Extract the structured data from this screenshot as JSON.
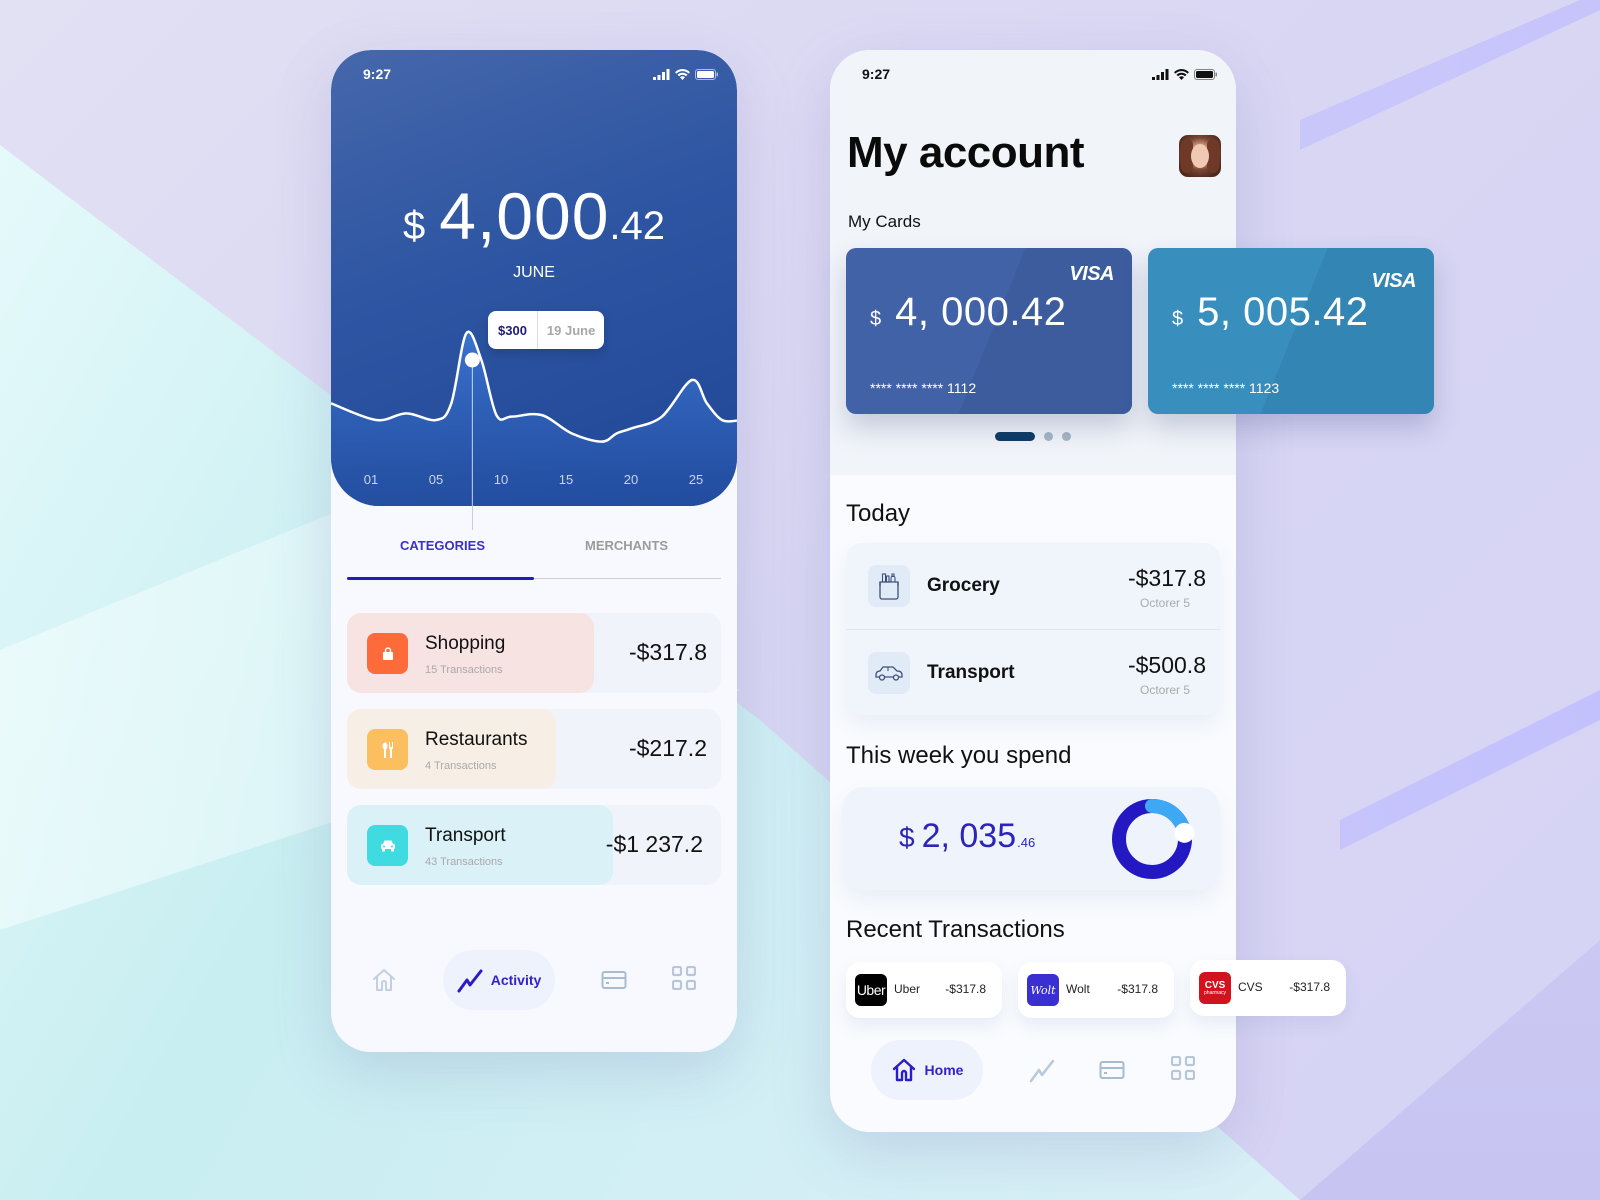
{
  "status_bar": {
    "time": "9:27"
  },
  "activity_screen": {
    "balance": {
      "currency": "$",
      "main": "4,000",
      "cents": ".42"
    },
    "month": "JUNE",
    "chart_data": {
      "type": "area",
      "title": "",
      "xlabel": "",
      "ylabel": "",
      "x_ticks": [
        "01",
        "05",
        "10",
        "15",
        "20",
        "25"
      ],
      "x": [
        0,
        3,
        5,
        7,
        8,
        9,
        10,
        11,
        12,
        14,
        16,
        18,
        19,
        20,
        22,
        24,
        25,
        26,
        27
      ],
      "y": [
        170,
        120,
        140,
        120,
        170,
        380,
        300,
        135,
        130,
        135,
        80,
        55,
        80,
        95,
        130,
        240,
        170,
        120,
        118
      ],
      "xlim": [
        0,
        27
      ],
      "ylim": [
        0,
        420
      ],
      "grid": false,
      "highlight": {
        "label": "$300",
        "date": "19 June",
        "x": 9.4,
        "y": 300
      }
    },
    "tabs": [
      {
        "label": "CATEGORIES",
        "active": true
      },
      {
        "label": "MERCHANTS",
        "active": false
      }
    ],
    "categories": [
      {
        "name": "Shopping",
        "count": "15 Transactions",
        "amount": "-$317.8",
        "fill_share": 0.66,
        "bg": "#f8e3e3",
        "icon_bg": "#fe6b3a",
        "icon": "shopping-bag-icon"
      },
      {
        "name": "Restaurants",
        "count": "4 Transactions",
        "amount": "-$217.2",
        "fill_share": 0.56,
        "bg": "#f7eee6",
        "icon_bg": "#fbbf60",
        "icon": "fork-knife-icon"
      },
      {
        "name": "Transport",
        "count": "43 Transactions",
        "amount": "-$1 237.2",
        "fill_share": 0.71,
        "bg": "#d9f1f7",
        "icon_bg": "#3fdbe0",
        "icon": "car-icon"
      }
    ],
    "nav": {
      "home": "Home",
      "activity": "Activity",
      "active": "activity"
    }
  },
  "account_screen": {
    "title": "My account",
    "my_cards_label": "My Cards",
    "cards": [
      {
        "brand": "VISA",
        "currency": "$",
        "amount": "4, 000.42",
        "pan": "**** **** **** 1112"
      },
      {
        "brand": "VISA",
        "currency": "$",
        "amount": "5, 005.42",
        "pan": "**** **** **** 1123"
      }
    ],
    "carousel": {
      "count": 3,
      "active_index": 0
    },
    "today_label": "Today",
    "today": [
      {
        "name": "Grocery",
        "amount": "-$317.8",
        "date": "Octorer 5",
        "icon": "grocery-bag-icon"
      },
      {
        "name": "Transport",
        "amount": "-$500.8",
        "date": "Octorer 5",
        "icon": "car-icon"
      }
    ],
    "week_label": "This week you spend",
    "week_spend": {
      "currency": "$",
      "amount": "2, 035",
      "cents": ".46",
      "progress": 0.22,
      "colors": {
        "main": "#2418c3",
        "highlight": "#3ea8f4"
      }
    },
    "recent_label": "Recent Transactions",
    "recent": [
      {
        "name": "Uber",
        "amount": "-$317.8",
        "logo_text": "Uber",
        "logo_bg": "#000000"
      },
      {
        "name": "Wolt",
        "amount": "-$317.8",
        "logo_text": "Wolt",
        "logo_bg": "#3a2fd1"
      },
      {
        "name": "CVS",
        "amount": "-$317.8",
        "logo_text": "CVS",
        "logo_sub": "pharmacy",
        "logo_bg": "#d1131e"
      }
    ],
    "nav": {
      "home": "Home",
      "active": "home"
    }
  }
}
